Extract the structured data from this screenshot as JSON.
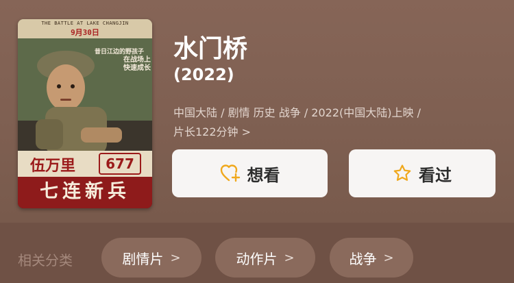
{
  "poster": {
    "en_title": "THE BATTLE AT LAKE CHANGJIN",
    "date": "9月30日",
    "slogan_line1": "昔日江边的野孩子",
    "slogan_line2": "在战场上快速成长",
    "name": "伍万里",
    "number": "677",
    "title": "七连新兵"
  },
  "movie": {
    "title": "水门桥",
    "year": "(2022)",
    "meta_line1": "中国大陆 / 剧情 历史 战争 / 2022(中国大陆)上映 /",
    "meta_line2": "片长122分钟",
    "meta_chevron": ">"
  },
  "actions": {
    "want_label": "想看",
    "seen_label": "看过",
    "want_icon": "heart-plus-icon",
    "seen_icon": "star-icon",
    "accent": "#f0a81c"
  },
  "related": {
    "label": "相关分类",
    "chips": [
      {
        "label": "剧情片",
        "chevron": ">"
      },
      {
        "label": "动作片",
        "chevron": ">"
      },
      {
        "label": "战争",
        "chevron": ">"
      }
    ]
  }
}
